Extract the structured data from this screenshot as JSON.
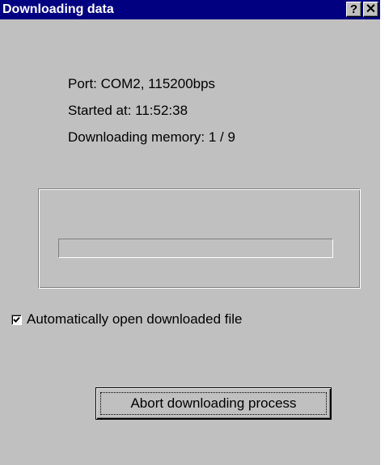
{
  "window": {
    "title": "Downloading data",
    "help_button_label": "?",
    "close_button_label": "✕",
    "titlebar_color": "#000080",
    "face_color": "#c0c0c0"
  },
  "info": {
    "port_line": "Port: COM2, 115200bps",
    "started_line": "Started at: 11:52:38",
    "memory_line": "Downloading memory: 1 / 9"
  },
  "progress": {
    "fraction": 0
  },
  "options": {
    "auto_open_label": "Automatically open downloaded file",
    "auto_open_checked": true
  },
  "actions": {
    "abort_label": "Abort downloading process"
  },
  "icons": {
    "help": "help-icon",
    "close": "close-icon",
    "check": "checkmark-icon"
  }
}
